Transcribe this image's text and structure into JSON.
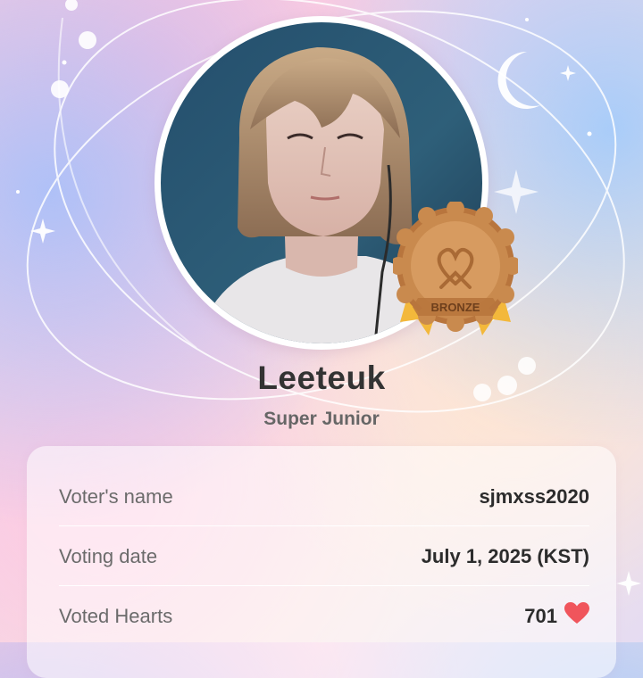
{
  "artist": {
    "name": "Leeteuk",
    "group": "Super Junior"
  },
  "badge": {
    "label": "BRONZE",
    "icon": "heart-ribbon-icon",
    "colors": {
      "medal": "#c98a4e",
      "ribbon": "#f3b83b"
    }
  },
  "vote_details": {
    "voter_label": "Voter's name",
    "voter_value": "sjmxss2020",
    "date_label": "Voting date",
    "date_value": "July 1, 2025 (KST)",
    "hearts_label": "Voted Hearts",
    "hearts_value": "701",
    "hearts_icon": "heart-icon"
  },
  "colors": {
    "heart": "#f0555c",
    "title_text": "#333333",
    "subtitle_text": "#666666"
  }
}
